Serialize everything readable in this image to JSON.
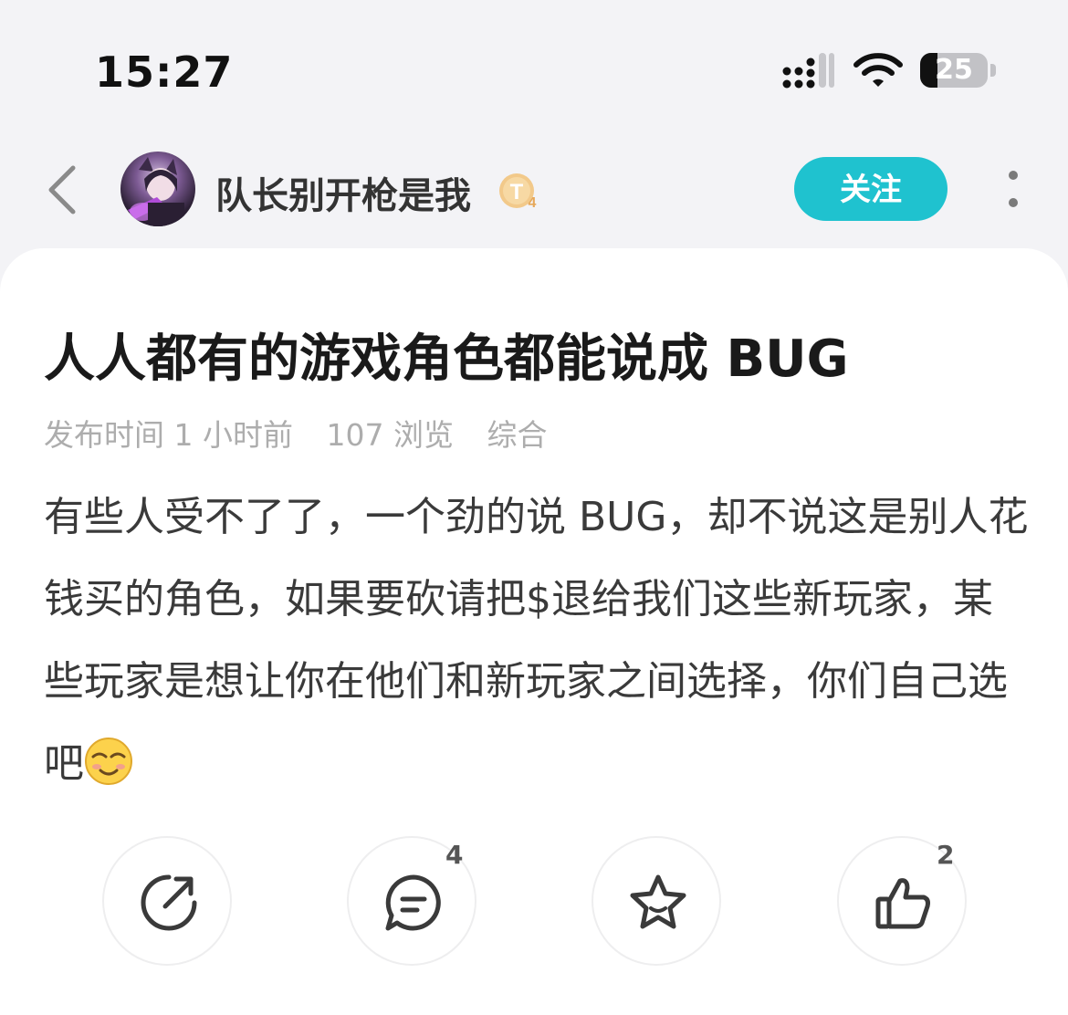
{
  "status_bar": {
    "time": "15:27",
    "battery": "25",
    "battery_level": 0.25
  },
  "header": {
    "username": "队长别开枪是我",
    "level_badge": "T4",
    "follow_label": "关注"
  },
  "post": {
    "title": "人人都有的游戏角色都能说成 BUG",
    "meta": {
      "published": "发布时间 1 小时前",
      "views": "107 浏览",
      "category": "综合"
    },
    "body": "有些人受不了了，一个劲的说 BUG，却不说这是别人花钱买的角色，如果要砍请把$退给我们这些新玩家，某些玩家是想让你在他们和新玩家之间选择，你们自己选吧"
  },
  "actions": {
    "comment_count": "4",
    "like_count": "2"
  },
  "colors": {
    "accent": "#1fc2cf",
    "badge": "#f0c27e"
  }
}
